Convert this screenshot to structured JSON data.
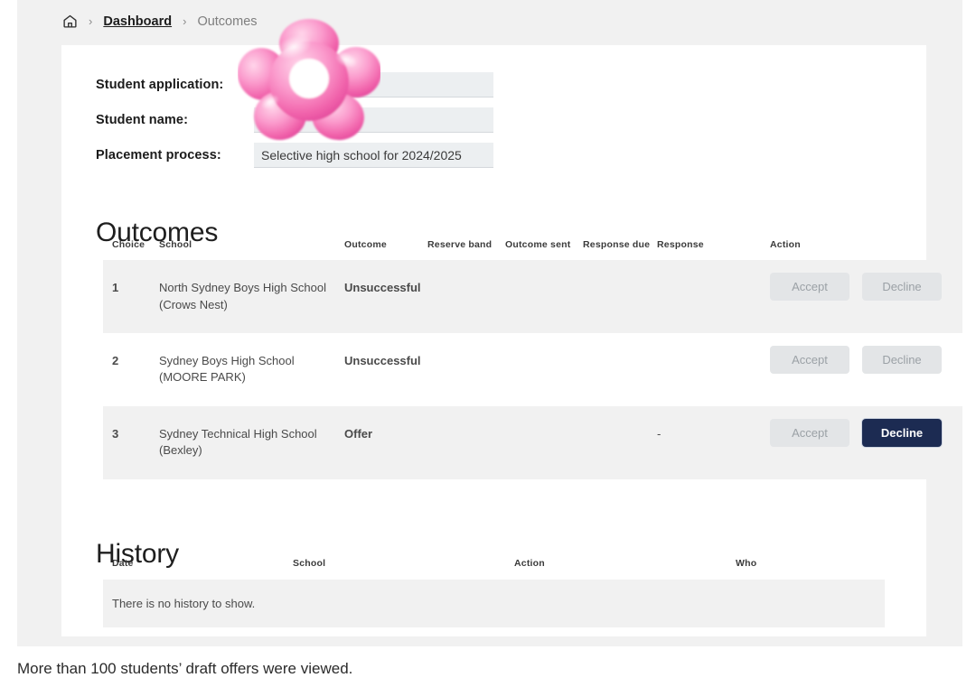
{
  "breadcrumb": {
    "home_icon": "home-icon",
    "separator": "›",
    "dashboard": "Dashboard",
    "current": "Outcomes"
  },
  "details": {
    "fields": [
      {
        "label": "Student application:",
        "value": ""
      },
      {
        "label": "Student name:",
        "value": ""
      },
      {
        "label": "Placement process:",
        "value": "Selective high school for 2024/2025"
      }
    ]
  },
  "outcomes": {
    "title": "Outcomes",
    "columns": [
      "Choice",
      "School",
      "Outcome",
      "Reserve band",
      "Outcome sent",
      "Response due",
      "Response",
      "Action"
    ],
    "rows": [
      {
        "choice": "1",
        "school": "North Sydney Boys High School (Crows Nest)",
        "outcome": "Unsuccessful",
        "reserve_band": "",
        "outcome_sent": "",
        "response_due": "",
        "response": "",
        "accept_label": "Accept",
        "accept_enabled": false,
        "decline_label": "Decline",
        "decline_enabled": false
      },
      {
        "choice": "2",
        "school": "Sydney Boys High School (MOORE PARK)",
        "outcome": "Unsuccessful",
        "reserve_band": "",
        "outcome_sent": "",
        "response_due": "",
        "response": "",
        "accept_label": "Accept",
        "accept_enabled": false,
        "decline_label": "Decline",
        "decline_enabled": false
      },
      {
        "choice": "3",
        "school": "Sydney Technical High School (Bexley)",
        "outcome": "Offer",
        "reserve_band": "",
        "outcome_sent": "",
        "response_due": "",
        "response": "-",
        "accept_label": "Accept",
        "accept_enabled": false,
        "decline_label": "Decline",
        "decline_enabled": true
      }
    ]
  },
  "history": {
    "title": "History",
    "columns": [
      "Date",
      "School",
      "Action",
      "Who"
    ],
    "empty_message": "There is no history to show."
  },
  "caption": "More than 100 students’ draft offers were viewed.",
  "colors": {
    "primary_button": "#1c2b52",
    "disabled_button": "#e3e5e7",
    "disabled_text": "#9ba1a6",
    "page_background": "#f1f1f1",
    "card_background": "#ffffff",
    "field_background": "#eceff1",
    "sticker_pink": "#f05fa8"
  },
  "sticker": {
    "name": "pink-flower-sticker"
  }
}
